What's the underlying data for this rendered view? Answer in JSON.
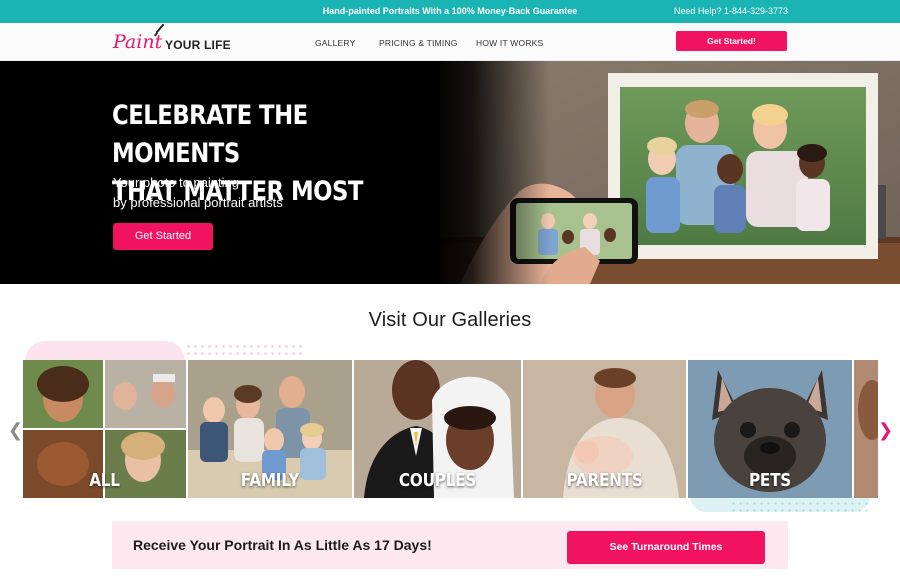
{
  "topbar": {
    "promo": "Hand-painted Portraits With a 100% Money-Back Guarantee",
    "help": "Need Help? 1-844-329-3773"
  },
  "header": {
    "logo_paint": "Paint",
    "logo_your_life": "YOUR LIFE",
    "nav": [
      "GALLERY",
      "PRICING & TIMING",
      "HOW IT WORKS"
    ],
    "cta": "Get Started!"
  },
  "hero": {
    "title_line1": "CELEBRATE THE MOMENTS",
    "title_line2": "THAT MATTER MOST",
    "subtitle_line1": "Your photo to painting",
    "subtitle_line2": "by professional portrait artists",
    "cta": "Get Started"
  },
  "galleries": {
    "title": "Visit Our Galleries",
    "tiles": [
      "ALL",
      "FAMILY",
      "COUPLES",
      "PARENTS",
      "PETS"
    ]
  },
  "turnaround": {
    "text": "Receive Your Portrait In As Little As 17 Days!",
    "cta": "See Turnaround Times"
  },
  "icons": {
    "carousel_prev": "chevron-left-icon",
    "carousel_next": "chevron-right-icon",
    "logo_brush": "paintbrush-icon"
  },
  "colors": {
    "brand_pink": "#f1135f",
    "topbar_teal": "#1bb4b4",
    "banner_pink": "#fde8ef"
  }
}
